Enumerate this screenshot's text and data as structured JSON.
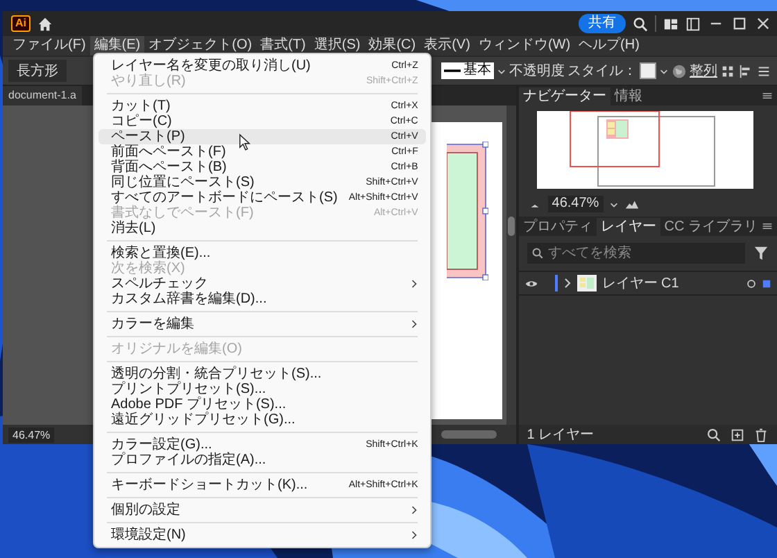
{
  "app": {
    "logo_text": "Ai",
    "share_label": "共有"
  },
  "menubar": [
    {
      "label": "ファイル(F)",
      "selected": false
    },
    {
      "label": "編集(E)",
      "selected": true
    },
    {
      "label": "オブジェクト(O)",
      "selected": false
    },
    {
      "label": "書式(T)",
      "selected": false
    },
    {
      "label": "選択(S)",
      "selected": false
    },
    {
      "label": "効果(C)",
      "selected": false
    },
    {
      "label": "表示(V)",
      "selected": false
    },
    {
      "label": "ウィンドウ(W)",
      "selected": false
    },
    {
      "label": "ヘルプ(H)",
      "selected": false
    }
  ],
  "control_bar": {
    "tool": "長方形",
    "stroke_profile": "基本",
    "opacity_label": "不透明度",
    "style_label": "スタイル：",
    "align_label": "整列"
  },
  "document": {
    "tab": "document-1.a",
    "zoom": "46.47%"
  },
  "edit_menu": {
    "items": [
      {
        "kind": "item",
        "label": "レイヤー名を変更の取り消し(U)",
        "shortcut": "Ctrl+Z",
        "disabled": false,
        "selected": false,
        "has_submenu": false
      },
      {
        "kind": "item",
        "label": "やり直し(R)",
        "shortcut": "Shift+Ctrl+Z",
        "disabled": true,
        "selected": false,
        "has_submenu": false
      },
      {
        "kind": "separator"
      },
      {
        "kind": "item",
        "label": "カット(T)",
        "shortcut": "Ctrl+X",
        "disabled": false,
        "selected": false,
        "has_submenu": false
      },
      {
        "kind": "item",
        "label": "コピー(C)",
        "shortcut": "Ctrl+C",
        "disabled": false,
        "selected": false,
        "has_submenu": false
      },
      {
        "kind": "item",
        "label": "ペースト(P)",
        "shortcut": "Ctrl+V",
        "disabled": false,
        "selected": true,
        "has_submenu": false
      },
      {
        "kind": "item",
        "label": "前面へペースト(F)",
        "shortcut": "Ctrl+F",
        "disabled": false,
        "selected": false,
        "has_submenu": false
      },
      {
        "kind": "item",
        "label": "背面へペースト(B)",
        "shortcut": "Ctrl+B",
        "disabled": false,
        "selected": false,
        "has_submenu": false
      },
      {
        "kind": "item",
        "label": "同じ位置にペースト(S)",
        "shortcut": "Shift+Ctrl+V",
        "disabled": false,
        "selected": false,
        "has_submenu": false
      },
      {
        "kind": "item",
        "label": "すべてのアートボードにペースト(S)",
        "shortcut": "Alt+Shift+Ctrl+V",
        "disabled": false,
        "selected": false,
        "has_submenu": false
      },
      {
        "kind": "item",
        "label": "書式なしでペースト(F)",
        "shortcut": "Alt+Ctrl+V",
        "disabled": true,
        "selected": false,
        "has_submenu": false
      },
      {
        "kind": "item",
        "label": "消去(L)",
        "disabled": false,
        "selected": false,
        "has_submenu": false
      },
      {
        "kind": "separator"
      },
      {
        "kind": "item",
        "label": "検索と置換(E)...",
        "disabled": false,
        "selected": false,
        "has_submenu": false
      },
      {
        "kind": "item",
        "label": "次を検索(X)",
        "disabled": true,
        "selected": false,
        "has_submenu": false
      },
      {
        "kind": "item",
        "label": "スペルチェック",
        "disabled": false,
        "selected": false,
        "has_submenu": true
      },
      {
        "kind": "item",
        "label": "カスタム辞書を編集(D)...",
        "disabled": false,
        "selected": false,
        "has_submenu": false
      },
      {
        "kind": "separator"
      },
      {
        "kind": "item",
        "label": "カラーを編集",
        "disabled": false,
        "selected": false,
        "has_submenu": true
      },
      {
        "kind": "separator"
      },
      {
        "kind": "item",
        "label": "オリジナルを編集(O)",
        "disabled": true,
        "selected": false,
        "has_submenu": false
      },
      {
        "kind": "separator"
      },
      {
        "kind": "item",
        "label": "透明の分割・統合プリセット(S)...",
        "disabled": false,
        "selected": false,
        "has_submenu": false
      },
      {
        "kind": "item",
        "label": "プリントプリセット(S)...",
        "disabled": false,
        "selected": false,
        "has_submenu": false
      },
      {
        "kind": "item",
        "label": "Adobe PDF プリセット(S)...",
        "disabled": false,
        "selected": false,
        "has_submenu": false
      },
      {
        "kind": "item",
        "label": "遠近グリッドプリセット(G)...",
        "disabled": false,
        "selected": false,
        "has_submenu": false
      },
      {
        "kind": "separator"
      },
      {
        "kind": "item",
        "label": "カラー設定(G)...",
        "shortcut": "Shift+Ctrl+K",
        "disabled": false,
        "selected": false,
        "has_submenu": false
      },
      {
        "kind": "item",
        "label": "プロファイルの指定(A)...",
        "disabled": false,
        "selected": false,
        "has_submenu": false
      },
      {
        "kind": "separator"
      },
      {
        "kind": "item",
        "label": "キーボードショートカット(K)...",
        "shortcut": "Alt+Shift+Ctrl+K",
        "disabled": false,
        "selected": false,
        "has_submenu": false
      },
      {
        "kind": "separator"
      },
      {
        "kind": "item",
        "label": "個別の設定",
        "disabled": false,
        "selected": false,
        "has_submenu": true
      },
      {
        "kind": "separator"
      },
      {
        "kind": "item",
        "label": "環境設定(N)",
        "disabled": false,
        "selected": false,
        "has_submenu": true
      }
    ]
  },
  "navigator": {
    "tabs": [
      {
        "label": "ナビゲーター",
        "selected": true
      },
      {
        "label": "情報",
        "selected": false
      }
    ],
    "zoom": "46.47%"
  },
  "layers_panel": {
    "tabs": [
      {
        "label": "プロパティ",
        "selected": false
      },
      {
        "label": "レイヤー",
        "selected": true
      },
      {
        "label": "CC ライブラリ",
        "selected": false
      }
    ],
    "search": {
      "placeholder": "すべてを検索"
    },
    "layers": [
      {
        "name": "レイヤー C1",
        "visible": true,
        "expanded": false,
        "color": "#4f7bff"
      }
    ],
    "status": "1 レイヤー"
  }
}
